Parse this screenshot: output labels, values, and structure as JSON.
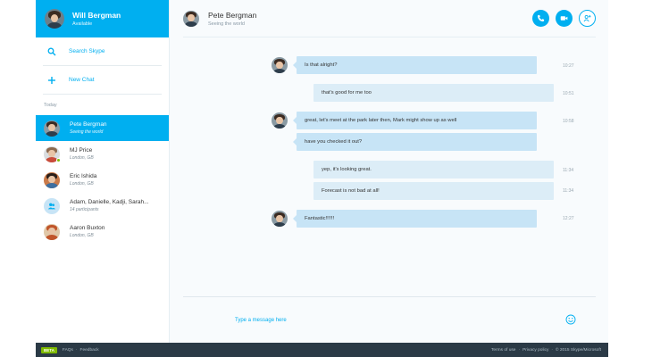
{
  "profile": {
    "name": "Will Bergman",
    "status": "Available"
  },
  "sidebar": {
    "search_label": "Search Skype",
    "new_chat_label": "New Chat",
    "section_label": "Today",
    "contacts": [
      {
        "name": "Pete Bergman",
        "sub": "Seeing the world"
      },
      {
        "name": "MJ Price",
        "sub": "London, GB"
      },
      {
        "name": "Eric Ishida",
        "sub": "London, GB"
      },
      {
        "name": "Adam, Danielle, Kadji, Sarah...",
        "sub": "14 participants"
      },
      {
        "name": "Aaron Buxton",
        "sub": "London, GB"
      }
    ]
  },
  "conversation": {
    "name": "Pete Bergman",
    "status": "Seeing the world",
    "messages": [
      {
        "text": "Is that alright?",
        "time": "10:27"
      },
      {
        "text": "that's good for me too",
        "time": "10:51"
      },
      {
        "text": "great, let's meet at the park later then, Mark might show up as well",
        "time": "10:58"
      },
      {
        "text": "have you checked it out?",
        "time": ""
      },
      {
        "text": "yep, it's looking great.",
        "time": "11:34"
      },
      {
        "text": "Forecast is not bad at all!",
        "time": "11:34"
      },
      {
        "text": "Fantastic!!!!!!",
        "time": "12:27"
      }
    ],
    "input_placeholder": "Type a message here"
  },
  "footer": {
    "beta": "BETA",
    "faqs": "FAQs",
    "feedback": "Feedback",
    "terms": "Terms of use",
    "privacy": "Privacy policy",
    "copyright": "© 2015 Skype/Microsoft"
  },
  "colors": {
    "accent": "#00aff0",
    "presence": "#7fba00",
    "footer": "#2b3a46",
    "bubble_in": "#c7e4f6",
    "bubble_out": "#dcedf7"
  },
  "icons": [
    "search-icon",
    "plus-icon",
    "call-icon",
    "video-icon",
    "add-person-icon",
    "group-icon",
    "smiley-icon"
  ]
}
